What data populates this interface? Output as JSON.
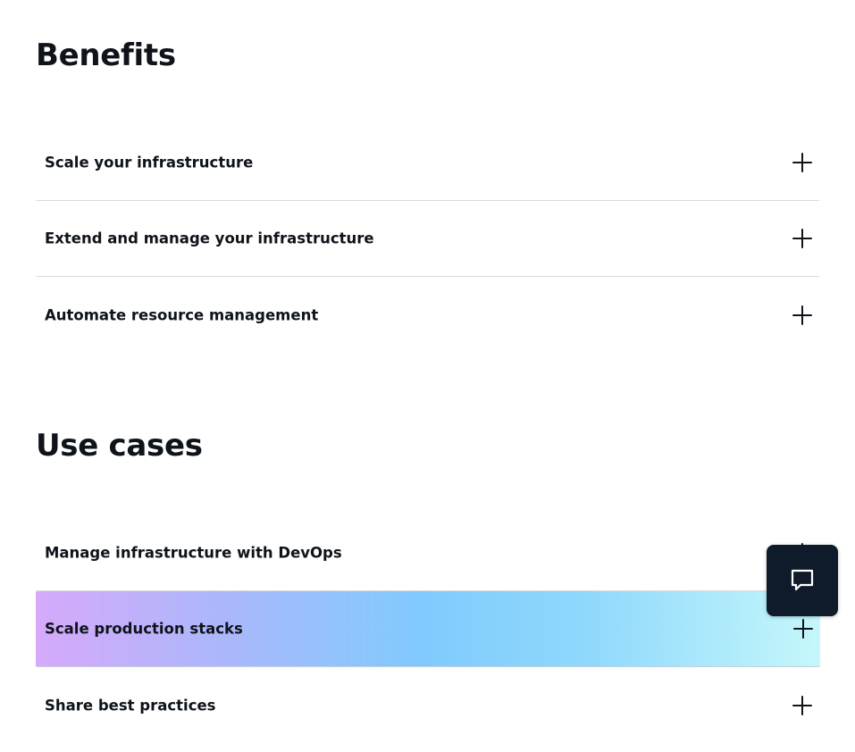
{
  "benefits": {
    "title": "Benefits",
    "items": [
      {
        "label": "Scale your infrastructure"
      },
      {
        "label": "Extend and manage your infrastructure"
      },
      {
        "label": "Automate resource management"
      }
    ]
  },
  "use_cases": {
    "title": "Use cases",
    "items": [
      {
        "label": "Manage infrastructure with DevOps"
      },
      {
        "label": "Scale production stacks"
      },
      {
        "label": "Share best practices"
      }
    ]
  },
  "icons": {
    "expand": "plus-icon",
    "chat": "chat-bubble-icon"
  },
  "colors": {
    "text": "#0f141a",
    "divider": "#d8dde3",
    "hover_gradient": [
      "#d6a9fb",
      "#7fcbfd",
      "#c5f7fb"
    ],
    "chat_button_bg": "#0f1b2a"
  }
}
